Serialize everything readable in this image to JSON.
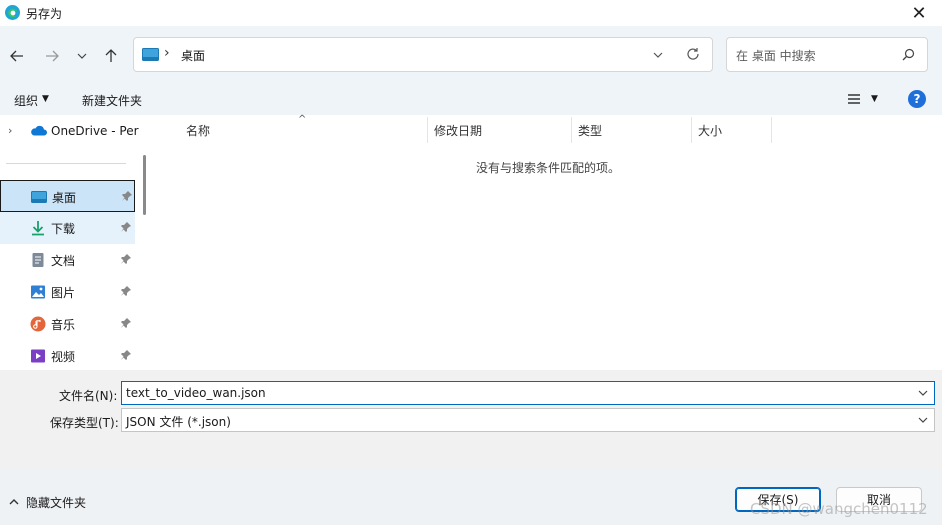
{
  "window": {
    "title": "另存为",
    "close_glyph": "✕"
  },
  "nav": {
    "breadcrumb_separator": "›",
    "address_text": "桌面",
    "search_placeholder": "在 桌面 中搜索"
  },
  "toolbar": {
    "organize_label": "组织",
    "new_folder_label": "新建文件夹",
    "help_glyph": "?"
  },
  "sidebar": {
    "onedrive_label": "OneDrive - Per",
    "items": [
      {
        "label": "桌面",
        "icon": "desktop-icon"
      },
      {
        "label": "下载",
        "icon": "download-icon"
      },
      {
        "label": "文档",
        "icon": "document-icon"
      },
      {
        "label": "图片",
        "icon": "picture-icon"
      },
      {
        "label": "音乐",
        "icon": "music-icon"
      },
      {
        "label": "视频",
        "icon": "video-icon"
      }
    ]
  },
  "file_list": {
    "columns": [
      "名称",
      "修改日期",
      "类型",
      "大小"
    ],
    "empty_message": "没有与搜索条件匹配的项。"
  },
  "save_form": {
    "filename_label": "文件名(N):",
    "filename_value": "text_to_video_wan.json",
    "filetype_label": "保存类型(T):",
    "filetype_value": "JSON 文件 (*.json)"
  },
  "footer": {
    "hide_folders_label": "隐藏文件夹",
    "save_label": "保存(S)",
    "cancel_label": "取消",
    "watermark": "CSDN @wangchen0112"
  },
  "colors": {
    "accent": "#0067c0",
    "selection": "#cce4f7",
    "nav_bg": "#eff4f9"
  }
}
